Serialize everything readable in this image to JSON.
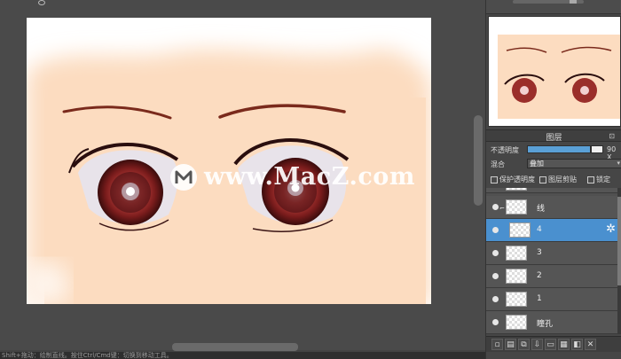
{
  "status": {
    "text": "Shift+拖动：绘制直线。按住Ctrl/Cmd键：切换到移动工具。"
  },
  "watermark": {
    "text": "www.MacZ.com",
    "logo": "M"
  },
  "layer_panel": {
    "title": "图层",
    "opacity_label": "不透明度",
    "opacity_value": "90 X",
    "opacity_fraction": 0.9,
    "blend_label": "混合",
    "blend_value": "叠加",
    "checkboxes": [
      "保护透明度",
      "图层剪贴",
      "锁定"
    ],
    "layers": [
      {
        "name": "线",
        "selected": false,
        "clipped": true
      },
      {
        "name": "4",
        "selected": true,
        "clipped": false
      },
      {
        "name": "3",
        "selected": false,
        "clipped": false
      },
      {
        "name": "2",
        "selected": false,
        "clipped": false
      },
      {
        "name": "1",
        "selected": false,
        "clipped": false
      },
      {
        "name": "瞳孔",
        "selected": false,
        "clipped": false
      }
    ]
  },
  "colors": {
    "accent": "#4a90cf",
    "skin": "#fcdcc0",
    "iris": "#8c2a26"
  }
}
